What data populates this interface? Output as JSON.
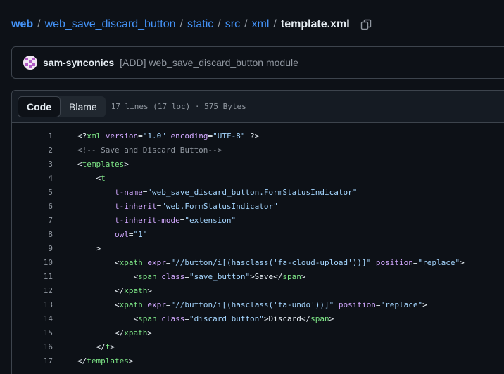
{
  "breadcrumb": {
    "items": [
      "web",
      "web_save_discard_button",
      "static",
      "src",
      "xml"
    ],
    "separator": "/",
    "file": "template.xml"
  },
  "commit": {
    "author": "sam-synconics",
    "message": "[ADD] web_save_discard_button module"
  },
  "file_header": {
    "tabs": [
      "Code",
      "Blame"
    ],
    "active_tab": "Code",
    "meta": "17 lines (17 loc) · 575 Bytes"
  },
  "colors": {
    "link": "#4493f8",
    "tag": "#7ee787",
    "attribute": "#d2a8ff",
    "string": "#a5d6ff",
    "comment": "#9198a1"
  },
  "code_lines": [
    {
      "n": "1",
      "tokens": [
        [
          "p",
          "<?"
        ],
        [
          "g",
          "xml"
        ],
        [
          "p",
          " "
        ],
        [
          "a",
          "version"
        ],
        [
          "p",
          "="
        ],
        [
          "s",
          "\"1.0\""
        ],
        [
          "p",
          " "
        ],
        [
          "a",
          "encoding"
        ],
        [
          "p",
          "="
        ],
        [
          "s",
          "\"UTF-8\""
        ],
        [
          "p",
          " ?>"
        ]
      ]
    },
    {
      "n": "2",
      "tokens": [
        [
          "c",
          "<!-- Save and Discard Button-->"
        ]
      ]
    },
    {
      "n": "3",
      "tokens": [
        [
          "p",
          "<"
        ],
        [
          "g",
          "templates"
        ],
        [
          "p",
          ">"
        ]
      ]
    },
    {
      "n": "4",
      "tokens": [
        [
          "p",
          "    <"
        ],
        [
          "g",
          "t"
        ]
      ]
    },
    {
      "n": "5",
      "tokens": [
        [
          "p",
          "        "
        ],
        [
          "a",
          "t-name"
        ],
        [
          "p",
          "="
        ],
        [
          "s",
          "\"web_save_discard_button.FormStatusIndicator\""
        ]
      ]
    },
    {
      "n": "6",
      "tokens": [
        [
          "p",
          "        "
        ],
        [
          "a",
          "t-inherit"
        ],
        [
          "p",
          "="
        ],
        [
          "s",
          "\"web.FormStatusIndicator\""
        ]
      ]
    },
    {
      "n": "7",
      "tokens": [
        [
          "p",
          "        "
        ],
        [
          "a",
          "t-inherit-mode"
        ],
        [
          "p",
          "="
        ],
        [
          "s",
          "\"extension\""
        ]
      ]
    },
    {
      "n": "8",
      "tokens": [
        [
          "p",
          "        "
        ],
        [
          "a",
          "owl"
        ],
        [
          "p",
          "="
        ],
        [
          "s",
          "\"1\""
        ]
      ]
    },
    {
      "n": "9",
      "tokens": [
        [
          "p",
          "    >"
        ]
      ]
    },
    {
      "n": "10",
      "tokens": [
        [
          "p",
          "        <"
        ],
        [
          "g",
          "xpath"
        ],
        [
          "p",
          " "
        ],
        [
          "a",
          "expr"
        ],
        [
          "p",
          "="
        ],
        [
          "s",
          "\"//button/i[(hasclass('fa-cloud-upload'))]\""
        ],
        [
          "p",
          " "
        ],
        [
          "a",
          "position"
        ],
        [
          "p",
          "="
        ],
        [
          "s",
          "\"replace\""
        ],
        [
          "p",
          ">"
        ]
      ]
    },
    {
      "n": "11",
      "tokens": [
        [
          "p",
          "            <"
        ],
        [
          "g",
          "span"
        ],
        [
          "p",
          " "
        ],
        [
          "a",
          "class"
        ],
        [
          "p",
          "="
        ],
        [
          "s",
          "\"save_button\""
        ],
        [
          "p",
          ">Save</"
        ],
        [
          "g",
          "span"
        ],
        [
          "p",
          ">"
        ]
      ]
    },
    {
      "n": "12",
      "tokens": [
        [
          "p",
          "        </"
        ],
        [
          "g",
          "xpath"
        ],
        [
          "p",
          ">"
        ]
      ]
    },
    {
      "n": "13",
      "tokens": [
        [
          "p",
          "        <"
        ],
        [
          "g",
          "xpath"
        ],
        [
          "p",
          " "
        ],
        [
          "a",
          "expr"
        ],
        [
          "p",
          "="
        ],
        [
          "s",
          "\"//button/i[(hasclass('fa-undo'))]\""
        ],
        [
          "p",
          " "
        ],
        [
          "a",
          "position"
        ],
        [
          "p",
          "="
        ],
        [
          "s",
          "\"replace\""
        ],
        [
          "p",
          ">"
        ]
      ]
    },
    {
      "n": "14",
      "tokens": [
        [
          "p",
          "            <"
        ],
        [
          "g",
          "span"
        ],
        [
          "p",
          " "
        ],
        [
          "a",
          "class"
        ],
        [
          "p",
          "="
        ],
        [
          "s",
          "\"discard_button\""
        ],
        [
          "p",
          ">Discard</"
        ],
        [
          "g",
          "span"
        ],
        [
          "p",
          ">"
        ]
      ]
    },
    {
      "n": "15",
      "tokens": [
        [
          "p",
          "        </"
        ],
        [
          "g",
          "xpath"
        ],
        [
          "p",
          ">"
        ]
      ]
    },
    {
      "n": "16",
      "tokens": [
        [
          "p",
          "    </"
        ],
        [
          "g",
          "t"
        ],
        [
          "p",
          ">"
        ]
      ]
    },
    {
      "n": "17",
      "tokens": [
        [
          "p",
          "</"
        ],
        [
          "g",
          "templates"
        ],
        [
          "p",
          ">"
        ]
      ]
    }
  ]
}
